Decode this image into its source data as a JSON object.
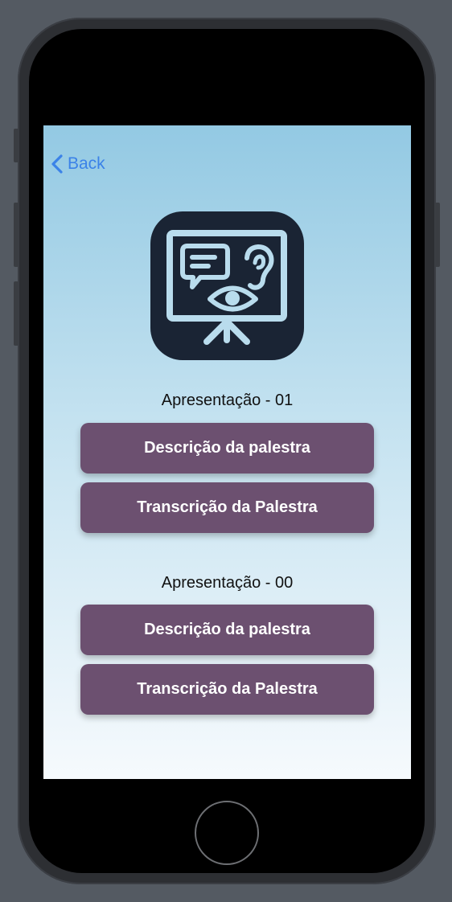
{
  "nav": {
    "back_label": "Back"
  },
  "sections": [
    {
      "title": "Apresentação - 01",
      "description_button": "Descrição da palestra",
      "transcription_button": "Transcrição da Palestra"
    },
    {
      "title": "Apresentação - 00",
      "description_button": "Descrição da palestra",
      "transcription_button": "Transcrição da Palestra"
    }
  ],
  "colors": {
    "accent": "#3b82e8",
    "button_bg": "#6c5070",
    "icon_bg": "#1a2434",
    "icon_fg": "#b9dced"
  },
  "icons": {
    "back": "chevron-left-icon",
    "app": "presentation-accessibility-icon"
  }
}
